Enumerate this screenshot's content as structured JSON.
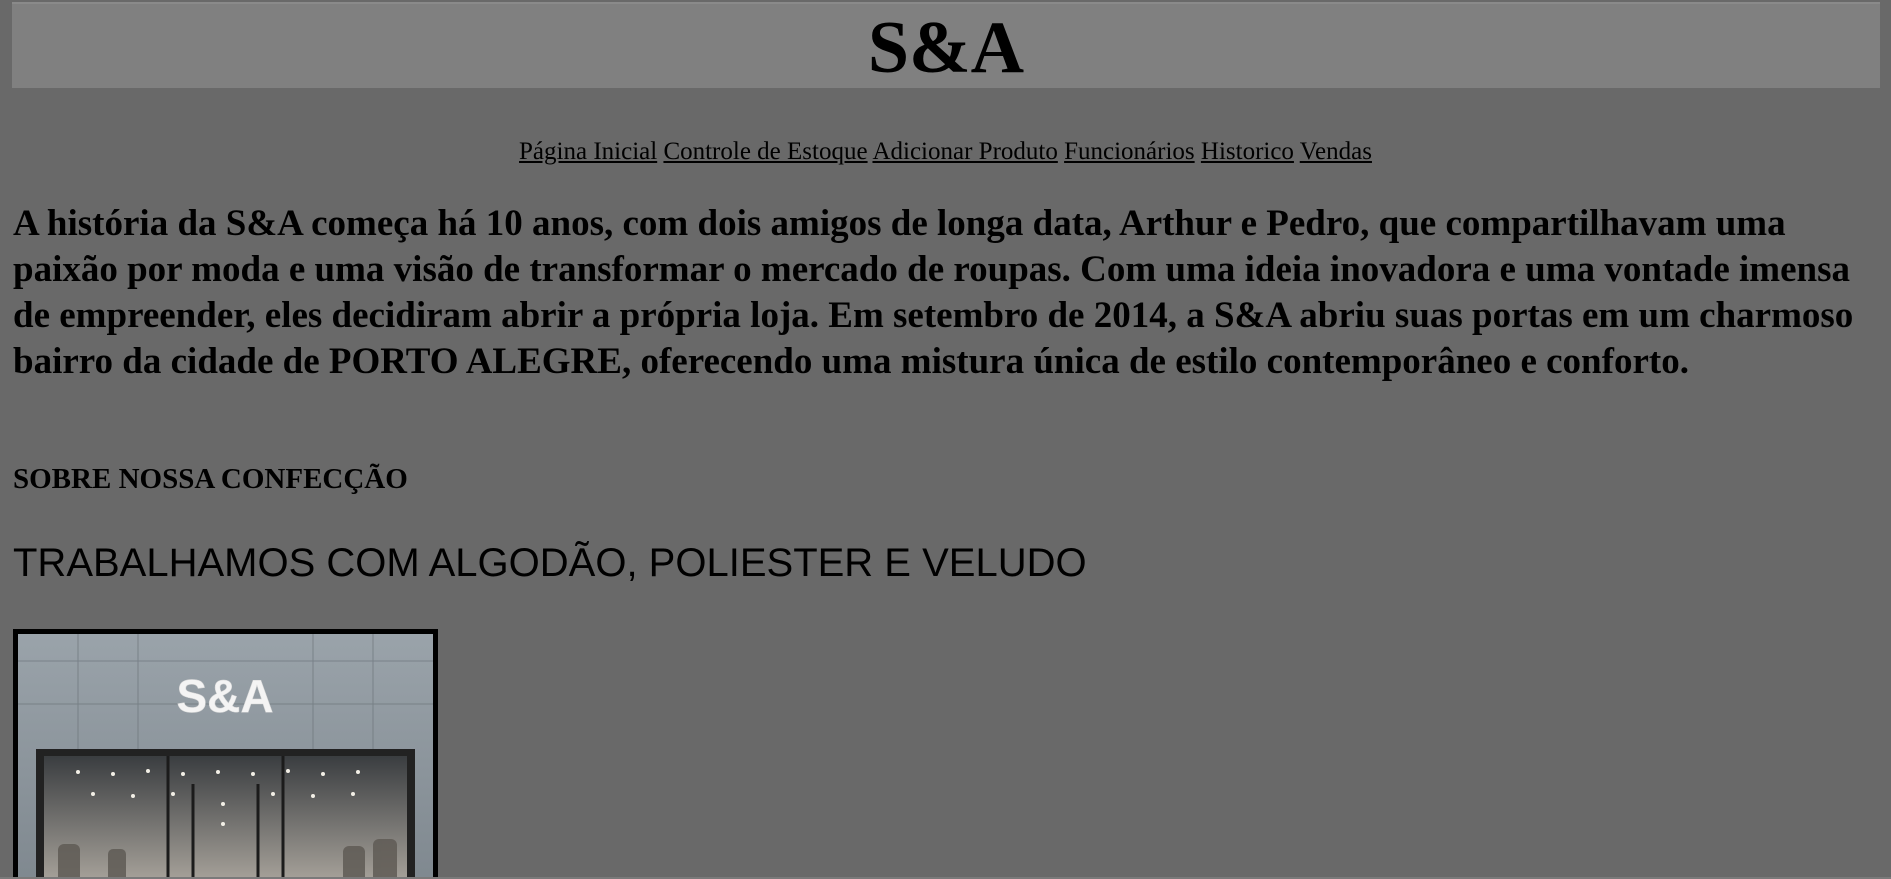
{
  "header": {
    "title": "S&A"
  },
  "nav": {
    "items": [
      {
        "label": "Página Inicial"
      },
      {
        "label": "Controle de Estoque"
      },
      {
        "label": "Adicionar Produto"
      },
      {
        "label": "Funcionários"
      },
      {
        "label": "Historico"
      },
      {
        "label": "Vendas"
      }
    ]
  },
  "main": {
    "history_text": "A história da S&A começa há 10 anos, com dois amigos de longa data, Arthur e Pedro, que compartilhavam uma paixão por moda e uma visão de transformar o mercado de roupas. Com uma ideia inovadora e uma vontade imensa de empreender, eles decidiram abrir a própria loja. Em setembro de 2014, a S&A abriu suas portas em um charmoso bairro da cidade de PORTO ALEGRE, oferecendo uma mistura única de estilo contemporâneo e conforto.",
    "about_heading": "SOBRE NOSSA CONFECÇÃO",
    "fabrics_text": "TRABALHAMOS COM ALGODÃO, POLIESTER E VELUDO",
    "store_image": {
      "sign_text": "S&A"
    }
  },
  "colors": {
    "page_background": "#696969",
    "header_background": "#808080",
    "text": "#000000"
  }
}
